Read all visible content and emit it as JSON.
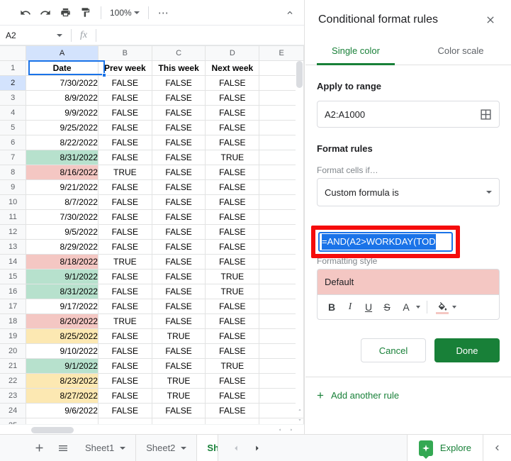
{
  "toolbar": {
    "undo": "undo-icon",
    "redo": "redo-icon",
    "print": "print-icon",
    "paint_format": "paint-format-icon",
    "zoom": "100%",
    "more": "⋯",
    "collapse": "collapse-menu-icon"
  },
  "formula_bar": {
    "namebox_value": "A2",
    "fx": "fx",
    "formula_value": ""
  },
  "grid": {
    "columns": [
      "A",
      "B",
      "C",
      "D",
      "E"
    ],
    "headers": [
      "Date",
      "Prev week",
      "This week",
      "Next week",
      ""
    ],
    "rows": [
      {
        "n": "2",
        "date": "7/30/2022",
        "prev": "FALSE",
        "this": "FALSE",
        "next": "FALSE",
        "fill": "none"
      },
      {
        "n": "3",
        "date": "8/9/2022",
        "prev": "FALSE",
        "this": "FALSE",
        "next": "FALSE",
        "fill": "none"
      },
      {
        "n": "4",
        "date": "9/9/2022",
        "prev": "FALSE",
        "this": "FALSE",
        "next": "FALSE",
        "fill": "none"
      },
      {
        "n": "5",
        "date": "9/25/2022",
        "prev": "FALSE",
        "this": "FALSE",
        "next": "FALSE",
        "fill": "none"
      },
      {
        "n": "6",
        "date": "8/22/2022",
        "prev": "FALSE",
        "this": "FALSE",
        "next": "FALSE",
        "fill": "none"
      },
      {
        "n": "7",
        "date": "8/31/2022",
        "prev": "FALSE",
        "this": "FALSE",
        "next": "TRUE",
        "fill": "green"
      },
      {
        "n": "8",
        "date": "8/16/2022",
        "prev": "TRUE",
        "this": "FALSE",
        "next": "FALSE",
        "fill": "red"
      },
      {
        "n": "9",
        "date": "9/21/2022",
        "prev": "FALSE",
        "this": "FALSE",
        "next": "FALSE",
        "fill": "none"
      },
      {
        "n": "10",
        "date": "8/7/2022",
        "prev": "FALSE",
        "this": "FALSE",
        "next": "FALSE",
        "fill": "none"
      },
      {
        "n": "11",
        "date": "7/30/2022",
        "prev": "FALSE",
        "this": "FALSE",
        "next": "FALSE",
        "fill": "none"
      },
      {
        "n": "12",
        "date": "9/5/2022",
        "prev": "FALSE",
        "this": "FALSE",
        "next": "FALSE",
        "fill": "none"
      },
      {
        "n": "13",
        "date": "8/29/2022",
        "prev": "FALSE",
        "this": "FALSE",
        "next": "FALSE",
        "fill": "none"
      },
      {
        "n": "14",
        "date": "8/18/2022",
        "prev": "TRUE",
        "this": "FALSE",
        "next": "FALSE",
        "fill": "red"
      },
      {
        "n": "15",
        "date": "9/1/2022",
        "prev": "FALSE",
        "this": "FALSE",
        "next": "TRUE",
        "fill": "green"
      },
      {
        "n": "16",
        "date": "8/31/2022",
        "prev": "FALSE",
        "this": "FALSE",
        "next": "TRUE",
        "fill": "green"
      },
      {
        "n": "17",
        "date": "9/17/2022",
        "prev": "FALSE",
        "this": "FALSE",
        "next": "FALSE",
        "fill": "none"
      },
      {
        "n": "18",
        "date": "8/20/2022",
        "prev": "TRUE",
        "this": "FALSE",
        "next": "FALSE",
        "fill": "red"
      },
      {
        "n": "19",
        "date": "8/25/2022",
        "prev": "FALSE",
        "this": "TRUE",
        "next": "FALSE",
        "fill": "yellow"
      },
      {
        "n": "20",
        "date": "9/10/2022",
        "prev": "FALSE",
        "this": "FALSE",
        "next": "FALSE",
        "fill": "none"
      },
      {
        "n": "21",
        "date": "9/1/2022",
        "prev": "FALSE",
        "this": "FALSE",
        "next": "TRUE",
        "fill": "green"
      },
      {
        "n": "22",
        "date": "8/23/2022",
        "prev": "FALSE",
        "this": "TRUE",
        "next": "FALSE",
        "fill": "yellow"
      },
      {
        "n": "23",
        "date": "8/27/2022",
        "prev": "FALSE",
        "this": "TRUE",
        "next": "FALSE",
        "fill": "yellow"
      },
      {
        "n": "24",
        "date": "9/6/2022",
        "prev": "FALSE",
        "this": "FALSE",
        "next": "FALSE",
        "fill": "none"
      },
      {
        "n": "25",
        "date": "",
        "prev": "",
        "this": "",
        "next": "",
        "fill": "none"
      }
    ],
    "selected_cell": "A2",
    "fill_colors": {
      "green": "#b7e1cd",
      "red": "#f4c7c3",
      "yellow": "#fce8b2",
      "none": "#ffffff"
    }
  },
  "panel": {
    "title": "Conditional format rules",
    "close_icon": "close-icon",
    "tabs": [
      {
        "label": "Single color",
        "active": true
      },
      {
        "label": "Color scale",
        "active": false
      }
    ],
    "apply_to_range_label": "Apply to range",
    "range_value": "A2:A1000",
    "range_picker_icon": "select-range-icon",
    "format_rules_label": "Format rules",
    "format_cells_if_label": "Format cells if…",
    "condition_value": "Custom formula is",
    "condition_caret": "chevron-down-icon",
    "formula_value": "=AND(A2>WORKDAY(TOD",
    "formula_selected": true,
    "formatting_style_label": "Formatting style",
    "style_preview_text": "Default",
    "style_preview_bg": "#f4c7c3",
    "style_buttons": [
      "B",
      "I",
      "U",
      "S",
      "A",
      "fill"
    ],
    "cancel_label": "Cancel",
    "done_label": "Done",
    "done_color": "#188038",
    "add_rule_label": "Add another rule",
    "add_rule_plus": "+",
    "annotation_color": "#f50c0c"
  },
  "bottom": {
    "add_sheet_icon": "plus-icon",
    "all_sheets_icon": "all-sheets-icon",
    "sheets": [
      {
        "label": "Sheet1",
        "active": false
      },
      {
        "label": "Sheet2",
        "active": false
      },
      {
        "label": "Sh",
        "active": true
      }
    ],
    "nav_prev": "prev-sheet-icon",
    "nav_next": "next-sheet-icon",
    "explore_label": "Explore",
    "explore_icon": "explore-icon",
    "panel_toggle_icon": "chevron-left-icon"
  }
}
